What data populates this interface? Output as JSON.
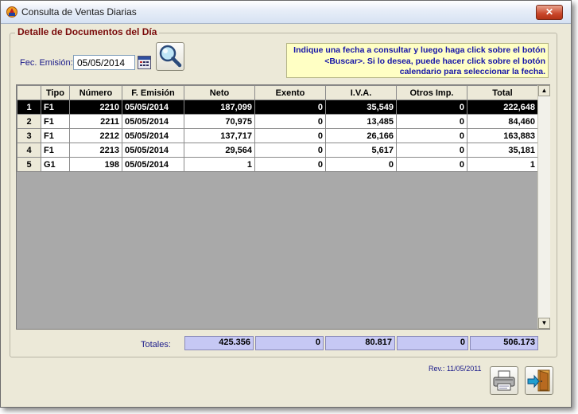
{
  "window": {
    "title": "Consulta de Ventas Diarias",
    "close_label": "✕"
  },
  "group": {
    "title": "Detalle de Documentos del Día"
  },
  "filter": {
    "label": "Fec. Emisión:",
    "date_value": "05/05/2014"
  },
  "hint": {
    "text": "Indique una fecha a consultar y luego haga click sobre el botón <Buscar>. Si lo desea, puede hacer click sobre el botón calendario para seleccionar la fecha."
  },
  "table": {
    "columns": [
      "",
      "Tipo",
      "Número",
      "F. Emisión",
      "Neto",
      "Exento",
      "I.V.A.",
      "Otros Imp.",
      "Total"
    ],
    "rows": [
      [
        "1",
        "F1",
        "2210",
        "05/05/2014",
        "187,099",
        "0",
        "35,549",
        "0",
        "222,648"
      ],
      [
        "2",
        "F1",
        "2211",
        "05/05/2014",
        "70,975",
        "0",
        "13,485",
        "0",
        "84,460"
      ],
      [
        "3",
        "F1",
        "2212",
        "05/05/2014",
        "137,717",
        "0",
        "26,166",
        "0",
        "163,883"
      ],
      [
        "4",
        "F1",
        "2213",
        "05/05/2014",
        "29,564",
        "0",
        "5,617",
        "0",
        "35,181"
      ],
      [
        "5",
        "G1",
        "198",
        "05/05/2014",
        "1",
        "0",
        "0",
        "0",
        "1"
      ]
    ],
    "selected_row": 0
  },
  "totals": {
    "label": "Totales:",
    "neto": "425.356",
    "exento": "0",
    "iva": "80.817",
    "otros": "0",
    "total": "506.173"
  },
  "footer": {
    "revision": "Rev.: 11/05/2011"
  },
  "icons": {
    "app": "app-icon",
    "calendar": "calendar-icon",
    "search": "magnifier-icon",
    "print": "printer-icon",
    "exit": "exit-door-icon"
  }
}
